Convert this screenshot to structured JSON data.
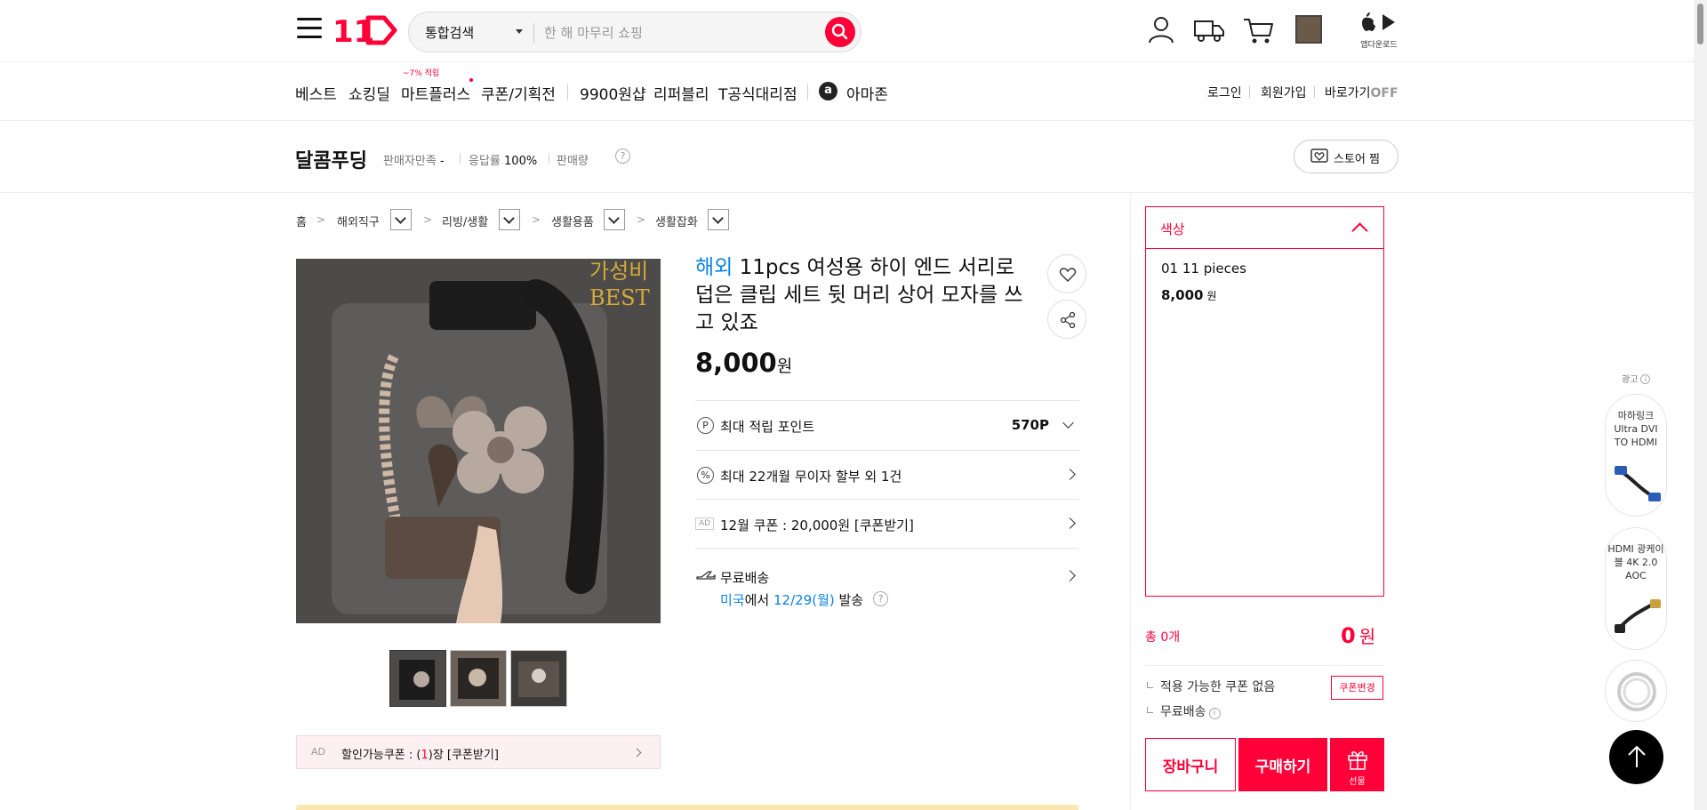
{
  "header": {
    "logo_text": "11",
    "search": {
      "category": "통합검색",
      "placeholder": "한 해 마무리 쇼핑"
    },
    "app_download_label": "앱다운로드"
  },
  "menu": {
    "items": [
      "베스트",
      "쇼킹딜",
      "마트플러스",
      "쿠폰/기획전",
      "9900원샵",
      "리퍼블리",
      "T공식대리점",
      "아마존"
    ],
    "badge": "~7% 적립",
    "amazon_icon": "a",
    "right": [
      "로그인",
      "회원가입"
    ],
    "shortcut_label": "바로가기",
    "shortcut_state": "OFF"
  },
  "store": {
    "name": "달콤푸딩",
    "satisfaction_label": "판매자만족",
    "satisfaction_value": "-",
    "response_label": "응답률",
    "response_value": "100%",
    "sales_label": "판매량",
    "help": "?",
    "follow_label": "스토어 찜"
  },
  "breadcrumb": [
    "홈",
    "해외직구",
    "리빙/생활",
    "생활용품",
    "생활잡화"
  ],
  "product": {
    "image_text_1": "가성비",
    "image_text_2": "BEST",
    "tag": "해외",
    "title": "11pcs 여성용 하이 엔드 서리로 덥은 클립 세트 뒷 머리 상어 모자를 쓰고 있죠",
    "price": "8,000",
    "price_unit": "원"
  },
  "benefits": {
    "points_icon": "P",
    "points_label": "최대 적립 포인트",
    "points_value": "570P",
    "installment_icon": "%",
    "installment_label": "최대 22개월 무이자 할부 외 1건",
    "ad_tag": "AD",
    "coupon_label": "12월 쿠폰 : 20,000원 [쿠폰받기]",
    "shipping_label": "무료배송",
    "shipping_origin": "미국",
    "shipping_mid": "에서 ",
    "shipping_date": "12/29(월)",
    "shipping_suffix": " 발송",
    "shipping_help": "?"
  },
  "coupon_bar": {
    "ad": "AD",
    "prefix": "할인가능쿠폰 : (",
    "count": "1",
    "suffix": ")장 [쿠폰받기]"
  },
  "options": {
    "header": "색상",
    "item_name": "01 11 pieces",
    "item_price": "8,000",
    "item_unit": "원"
  },
  "summary": {
    "total_label": "총 0개",
    "total_amount": "0",
    "total_unit": "원",
    "coupon_none": "적용 가능한 쿠폰 없음",
    "coupon_change": "쿠폰변경",
    "shipping": "무료배송",
    "info": "i"
  },
  "actions": {
    "cart": "장바구니",
    "buy": "구매하기",
    "gift": "선물"
  },
  "side_ads": {
    "label": "광고",
    "info": "i",
    "items": [
      "마하링크 Ultra DVI TO HDMI",
      "HDMI 광케이블 4K 2.0 AOC"
    ]
  },
  "colors": {
    "brand": "#ff0038",
    "link_blue": "#0b83e6"
  }
}
